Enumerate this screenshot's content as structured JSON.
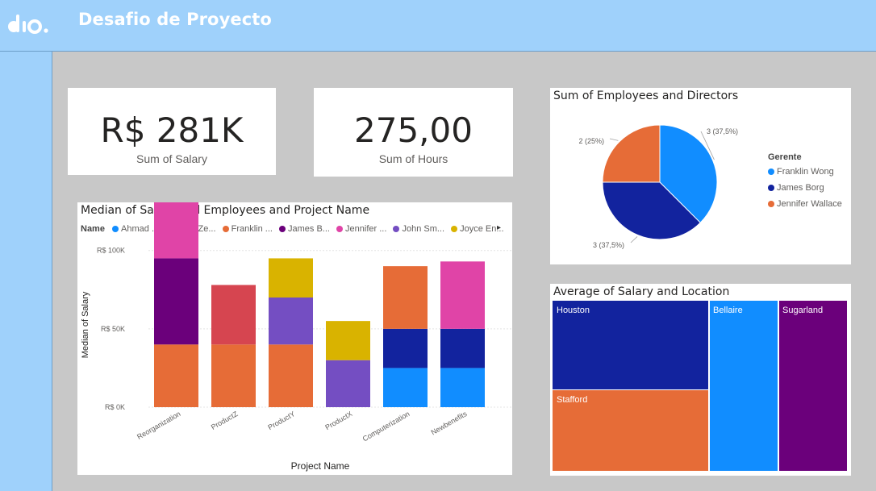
{
  "header": {
    "title": "Desafio de Proyecto",
    "logo_icon": "dio-logo-icon"
  },
  "kpis": [
    {
      "value": "R$ 281K",
      "label": "Sum of Salary"
    },
    {
      "value": "275,00",
      "label": "Sum of Hours"
    }
  ],
  "colors": {
    "ahmad": "#118dff",
    "alicia": "#12239e",
    "franklin": "#e66c37",
    "james": "#6b007b",
    "jennifer": "#e044a7",
    "john": "#744ec2",
    "joyce": "#d9b300",
    "extra": "#d64550",
    "background": "#c8c8c8",
    "header": "#9fd1fb"
  },
  "bar_chart": {
    "title": "Median of Salary and Employees and Project Name",
    "legend_title": "Name",
    "legend_items": [
      {
        "label": "Ahmad ...",
        "color": "#118dff"
      },
      {
        "label": "Alicia Ze...",
        "color": "#12239e"
      },
      {
        "label": "Franklin ...",
        "color": "#e66c37"
      },
      {
        "label": "James B...",
        "color": "#6b007b"
      },
      {
        "label": "Jennifer ...",
        "color": "#e044a7"
      },
      {
        "label": "John Sm...",
        "color": "#744ec2"
      },
      {
        "label": "Joyce En...",
        "color": "#d9b300"
      }
    ],
    "scroll_arrow": "▸"
  },
  "pie_chart": {
    "title": "Sum of Employees and Directors",
    "legend_title": "Gerente",
    "legend_items": [
      {
        "label": "Franklin Wong",
        "color": "#118dff"
      },
      {
        "label": "James Borg",
        "color": "#12239e"
      },
      {
        "label": "Jennifer Wallace",
        "color": "#e66c37"
      }
    ]
  },
  "treemap": {
    "title": "Average of Salary and Location",
    "cells": [
      {
        "label": "Houston",
        "color": "#12239e"
      },
      {
        "label": "Stafford",
        "color": "#e66c37"
      },
      {
        "label": "Bellaire",
        "color": "#118dff"
      },
      {
        "label": "Sugarland",
        "color": "#6b007b"
      }
    ]
  },
  "chart_data": [
    {
      "type": "bar",
      "stacked": true,
      "title": "Median of Salary and Employees and Project Name",
      "xlabel": "Project Name",
      "ylabel": "Median of Salary",
      "ylim": [
        0,
        105000
      ],
      "yticks": [
        0,
        50000,
        100000
      ],
      "ytick_labels": [
        "R$ 0K",
        "R$ 50K",
        "R$ 100K"
      ],
      "categories": [
        "Reorganization",
        "ProductZ",
        "ProductY",
        "ProductX",
        "Computerization",
        "Newbenefits"
      ],
      "legend": "top",
      "grid": true,
      "segments": [
        [
          {
            "color": "#e66c37",
            "value": 40000
          },
          {
            "color": "#6b007b",
            "value": 55000
          },
          {
            "color": "#e044a7",
            "value": 43000
          }
        ],
        [
          {
            "color": "#e66c37",
            "value": 40000
          },
          {
            "color": "#d64550",
            "value": 38000
          }
        ],
        [
          {
            "color": "#e66c37",
            "value": 40000
          },
          {
            "color": "#744ec2",
            "value": 30000
          },
          {
            "color": "#d9b300",
            "value": 25000
          }
        ],
        [
          {
            "color": "#744ec2",
            "value": 30000
          },
          {
            "color": "#d9b300",
            "value": 25000
          }
        ],
        [
          {
            "color": "#118dff",
            "value": 25000
          },
          {
            "color": "#12239e",
            "value": 25000
          },
          {
            "color": "#e66c37",
            "value": 40000
          }
        ],
        [
          {
            "color": "#118dff",
            "value": 25000
          },
          {
            "color": "#12239e",
            "value": 25000
          },
          {
            "color": "#e044a7",
            "value": 43000
          }
        ]
      ]
    },
    {
      "type": "pie",
      "title": "Sum of Employees and Directors",
      "legend": "right",
      "slices": [
        {
          "name": "Franklin Wong",
          "value": 3,
          "label": "3 (37,5%)",
          "color": "#118dff"
        },
        {
          "name": "James Borg",
          "value": 3,
          "label": "3 (37,5%)",
          "color": "#12239e"
        },
        {
          "name": "Jennifer Wallace",
          "value": 2,
          "label": "2 (25%)",
          "color": "#e66c37"
        }
      ]
    }
  ]
}
